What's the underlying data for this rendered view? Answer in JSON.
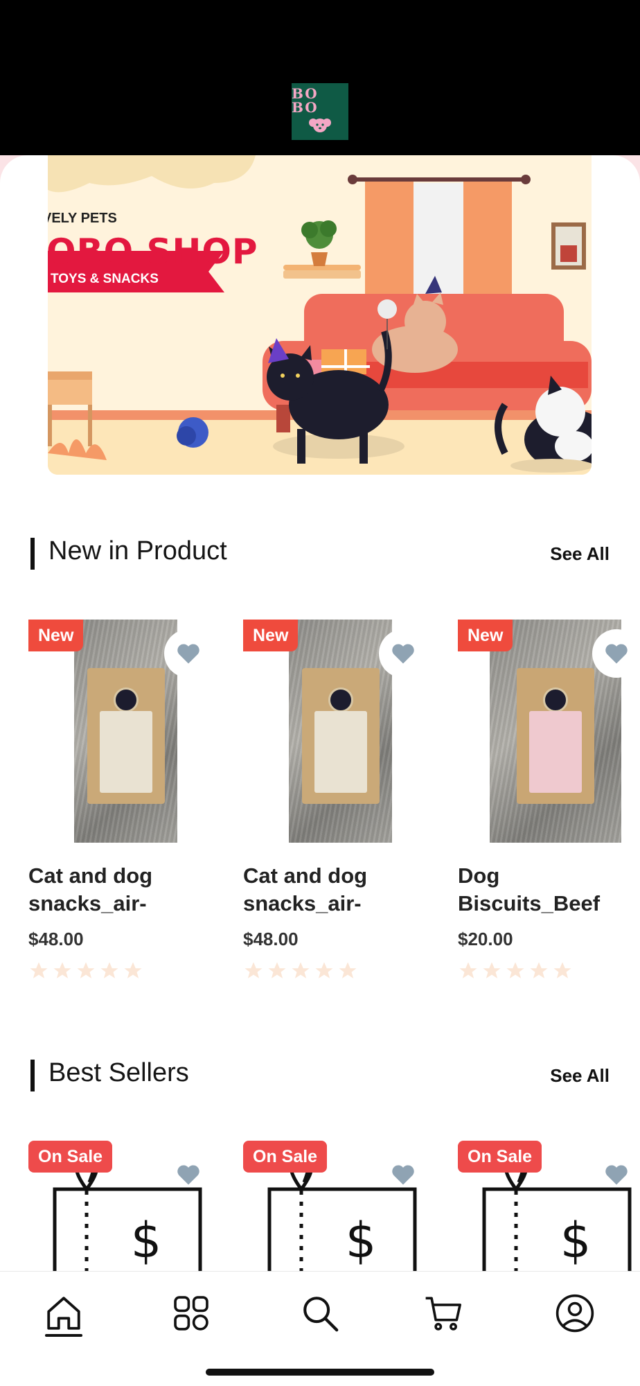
{
  "brand": {
    "logo_text": "BO BO",
    "logo_bg": "#0f5a45",
    "logo_fg": "#f4a7c5"
  },
  "banner": {
    "kicker": "VELY PETS",
    "title": "OBO SHOP",
    "ribbon": "TOYS & SNACKS"
  },
  "new_products": {
    "title": "New in Product",
    "see_all": "See All",
    "items": [
      {
        "badge": "New",
        "name": "Cat and dog snacks_air-",
        "price": "$48.00",
        "rating": 0
      },
      {
        "badge": "New",
        "name": "Cat and dog snacks_air-",
        "price": "$48.00",
        "rating": 0
      },
      {
        "badge": "New",
        "name": "Dog Biscuits_Beef",
        "price": "$20.00",
        "rating": 0
      }
    ]
  },
  "best_sellers": {
    "title": "Best Sellers",
    "see_all": "See All",
    "items": [
      {
        "badge": "On Sale"
      },
      {
        "badge": "On Sale"
      },
      {
        "badge": "On Sale"
      }
    ]
  },
  "tabs": [
    {
      "icon": "home-icon",
      "active": true
    },
    {
      "icon": "grid-icon",
      "active": false
    },
    {
      "icon": "search-icon",
      "active": false
    },
    {
      "icon": "cart-icon",
      "active": false
    },
    {
      "icon": "profile-icon",
      "active": false
    }
  ],
  "colors": {
    "accent": "#ef4b3d",
    "heart": "#8fa3b3",
    "star": "#fbe6d6"
  }
}
